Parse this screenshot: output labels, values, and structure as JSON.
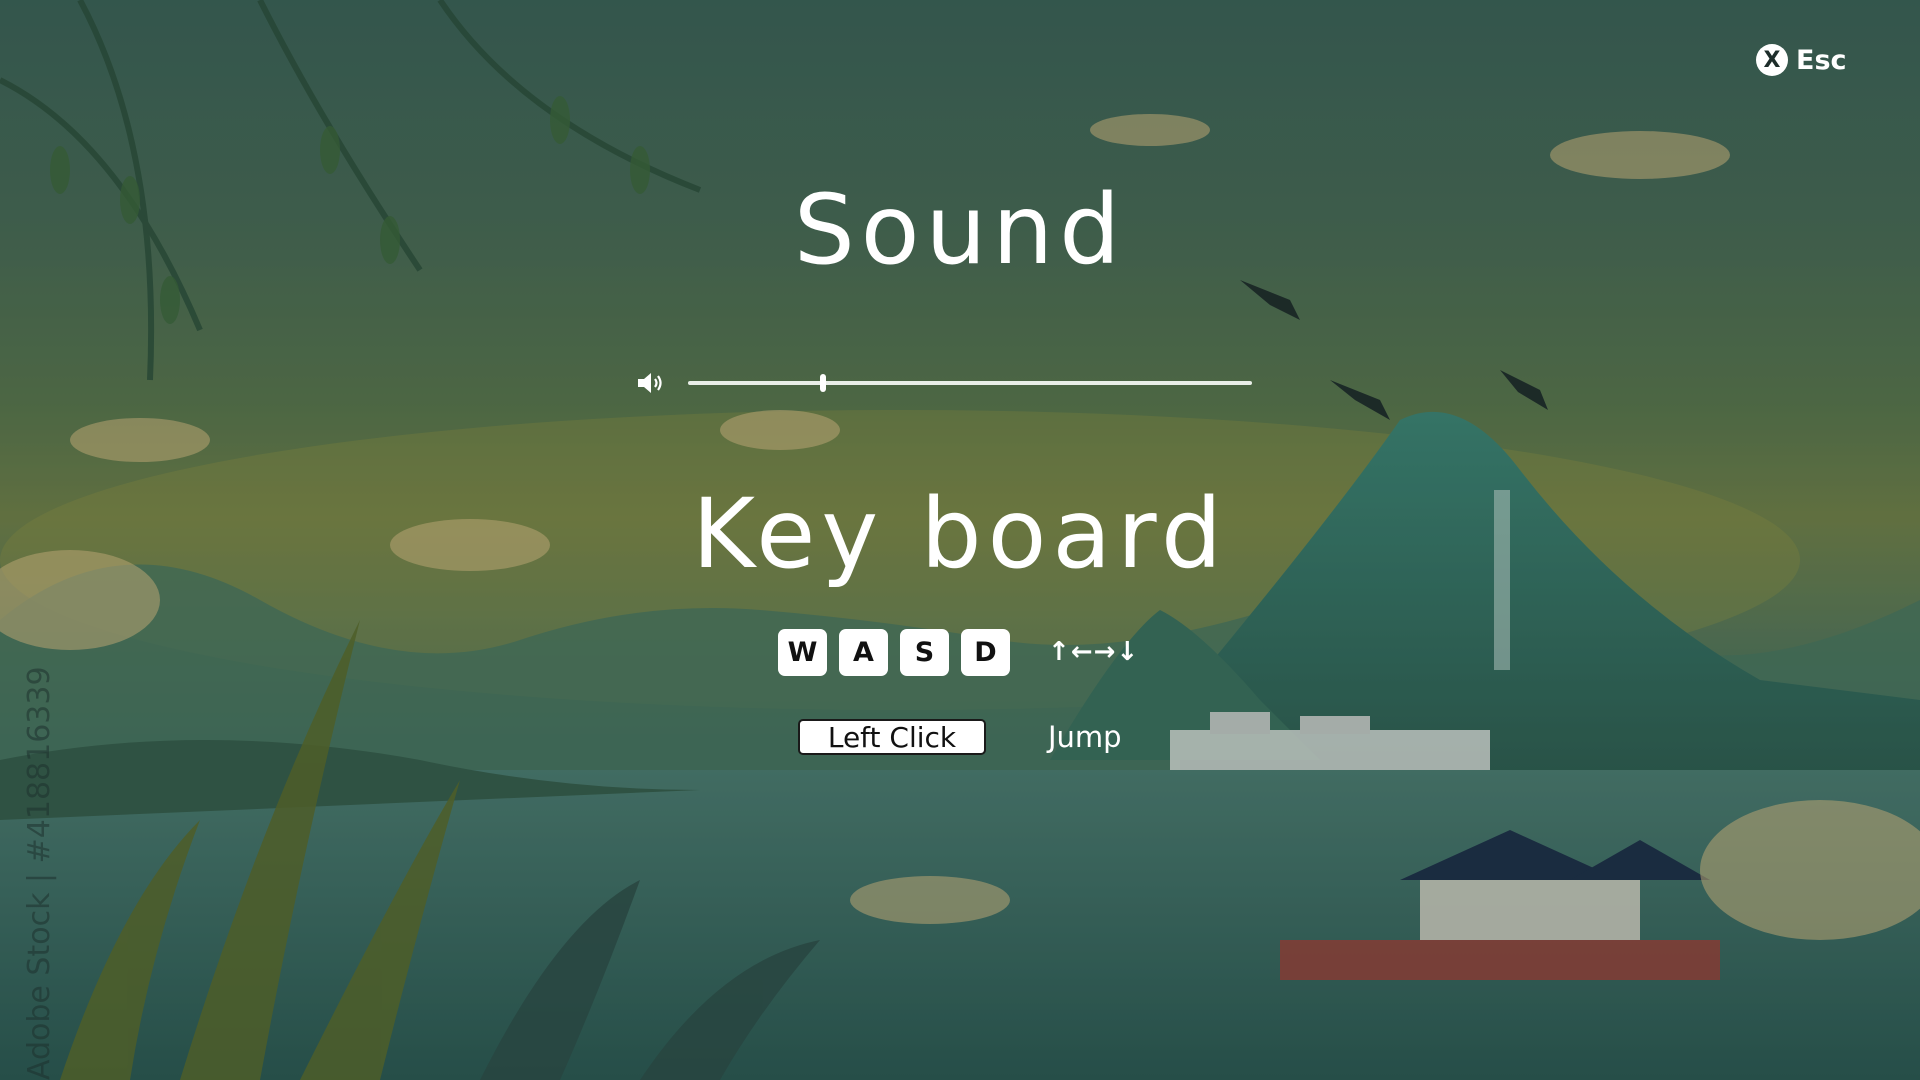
{
  "esc": {
    "icon_letter": "X",
    "label": "Esc"
  },
  "sound": {
    "title": "Sound",
    "volume_level": 0.24
  },
  "keyboard": {
    "title": "Key board",
    "keys": [
      "W",
      "A",
      "S",
      "D"
    ],
    "arrows": "↑←→↓",
    "click_label": "Left Click",
    "click_action": "Jump"
  },
  "watermark": "Adobe Stock | #418816339",
  "icons": [
    "close-icon",
    "volume-icon"
  ]
}
